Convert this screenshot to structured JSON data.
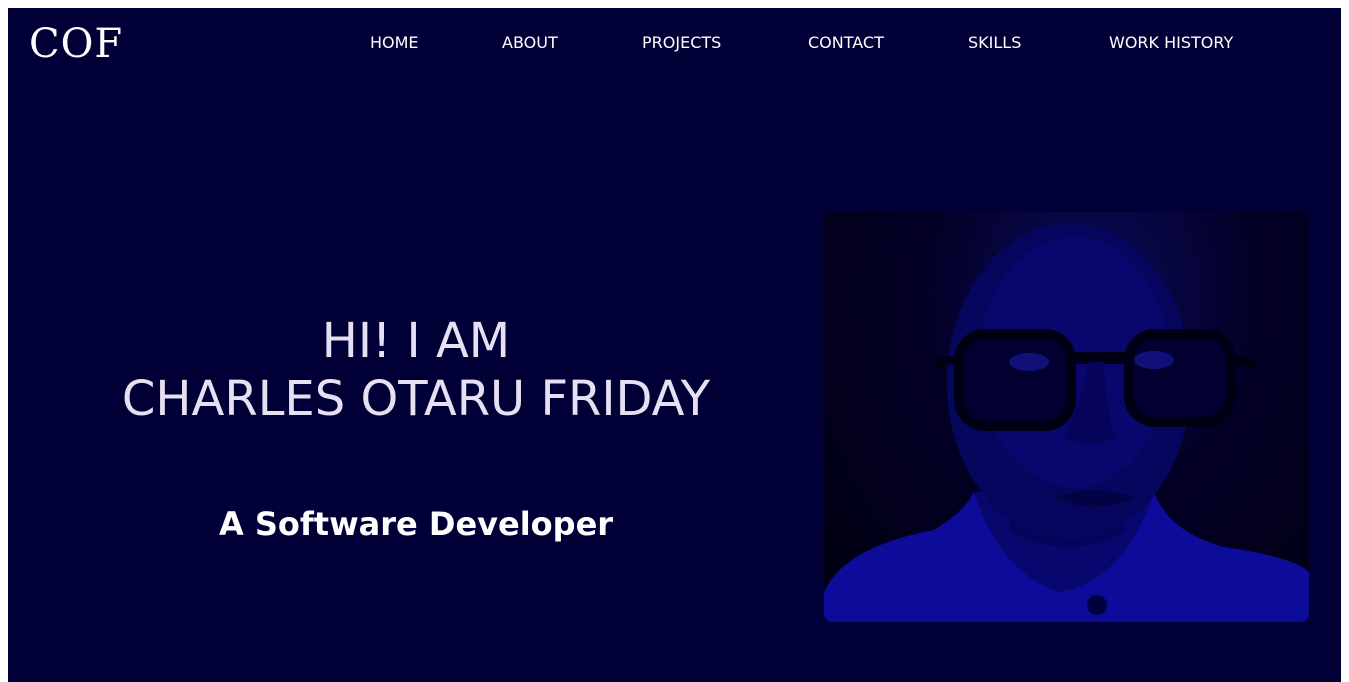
{
  "brand": {
    "logo": "COF"
  },
  "nav": {
    "items": [
      {
        "label": "HOME"
      },
      {
        "label": "ABOUT"
      },
      {
        "label": "PROJECTS"
      },
      {
        "label": "CONTACT"
      },
      {
        "label": "SKILLS"
      },
      {
        "label": "WORK HISTORY"
      }
    ]
  },
  "hero": {
    "greeting": "HI! I AM",
    "name": "CHARLES OTARU FRIDAY",
    "role": "A Software Developer"
  },
  "colors": {
    "background": "#010036",
    "text": "#ffffff",
    "hero_text": "#e6e0f2",
    "photo_tint": "#0d0c9a"
  }
}
